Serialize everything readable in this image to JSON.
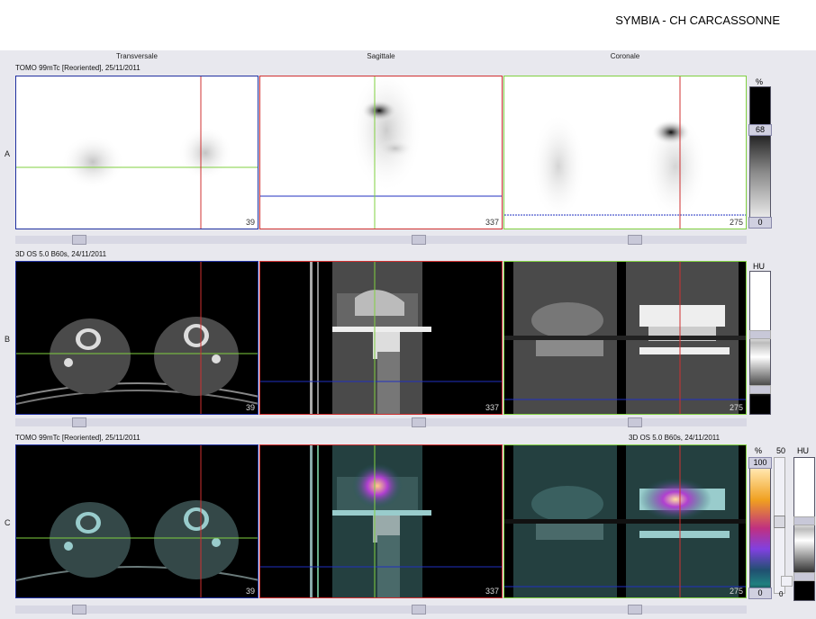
{
  "header": {
    "title": "SYMBIA - CH CARCASSONNE"
  },
  "columns": [
    "Transversale",
    "Sagittale",
    "Coronale"
  ],
  "rows": {
    "a": {
      "label": "A",
      "series": "TOMO 99mTc [Reoriented], 25/11/2011"
    },
    "b": {
      "label": "B",
      "series": "3D  OS  5.0  B60s, 24/11/2011"
    },
    "c": {
      "label": "C",
      "series_left": "TOMO 99mTc [Reoriented], 25/11/2011",
      "series_right": "3D  OS  5.0  B60s, 24/11/2011"
    }
  },
  "slices": {
    "transversale": "39",
    "sagittale": "337",
    "coronale": "275"
  },
  "colorbars": {
    "a": {
      "unit": "%",
      "window_top": "68",
      "window_bottom": "0"
    },
    "b": {
      "unit": "HU"
    },
    "c": {
      "unit_pct": "%",
      "value_50": "50",
      "unit_hu": "HU",
      "top": "100",
      "bottom": "0",
      "small_zero": "0"
    }
  },
  "colors": {
    "crosshair_red": "#d03030",
    "crosshair_green": "#80d040",
    "crosshair_blue": "#2030c0"
  }
}
